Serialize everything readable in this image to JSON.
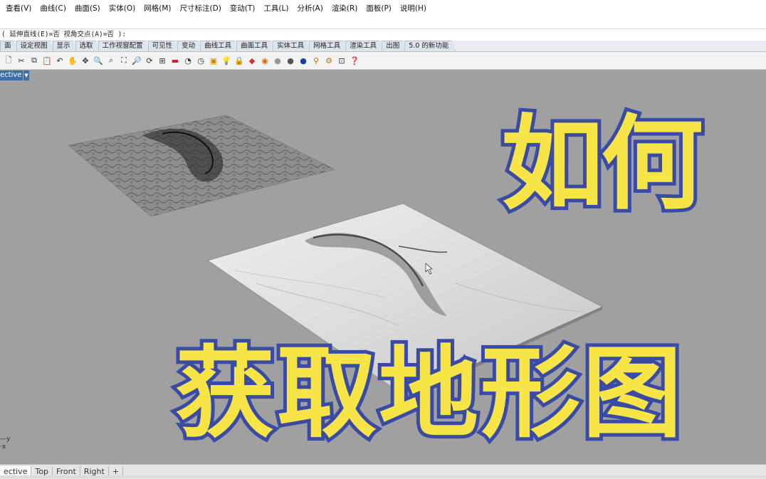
{
  "menu": [
    "查看(V)",
    "曲线(C)",
    "曲面(S)",
    "实体(O)",
    "网格(M)",
    "尺寸标注(D)",
    "变动(T)",
    "工具(L)",
    "分析(A)",
    "渲染(R)",
    "面板(P)",
    "说明(H)"
  ],
  "command_prompt": "( 延伸直线(E)=否  视角交点(A)=否 ):",
  "toolbar_tabs": [
    "面",
    "设定视图",
    "显示",
    "选取",
    "工作视窗配置",
    "可见性",
    "变动",
    "曲线工具",
    "曲面工具",
    "实体工具",
    "网格工具",
    "渲染工具",
    "出图",
    "5.0 的新功能"
  ],
  "toolbar_icons": [
    "new-icon",
    "cut-icon",
    "copy-icon",
    "paste-icon",
    "undo-icon",
    "pan-icon",
    "move-icon",
    "zoom-icon",
    "zoom-window-icon",
    "zoom-extents-icon",
    "zoom-selected-icon",
    "rotate-view-icon",
    "four-views-icon",
    "car-icon",
    "camera-icon",
    "clock-icon",
    "named-view-icon",
    "light-icon",
    "lock-icon",
    "layer-icon",
    "color-wheel-icon",
    "sphere-white-icon",
    "sphere-gray-icon",
    "sphere-blue-icon",
    "pin-icon",
    "gear-icon",
    "grid-snap-icon",
    "help-icon"
  ],
  "viewport": {
    "label": "ective",
    "axis_y": "y",
    "axis_x": "x"
  },
  "overlay_text": {
    "line1": "如何",
    "line2": "获取地形图"
  },
  "viewport_tabs": [
    "ective",
    "Top",
    "Front",
    "Right",
    "+"
  ],
  "colors": {
    "overlay_fill": "#f7e447",
    "overlay_stroke": "#3a4ba6",
    "viewport_bg": "#a0a0a0",
    "active_label": "#3d6ea8"
  }
}
